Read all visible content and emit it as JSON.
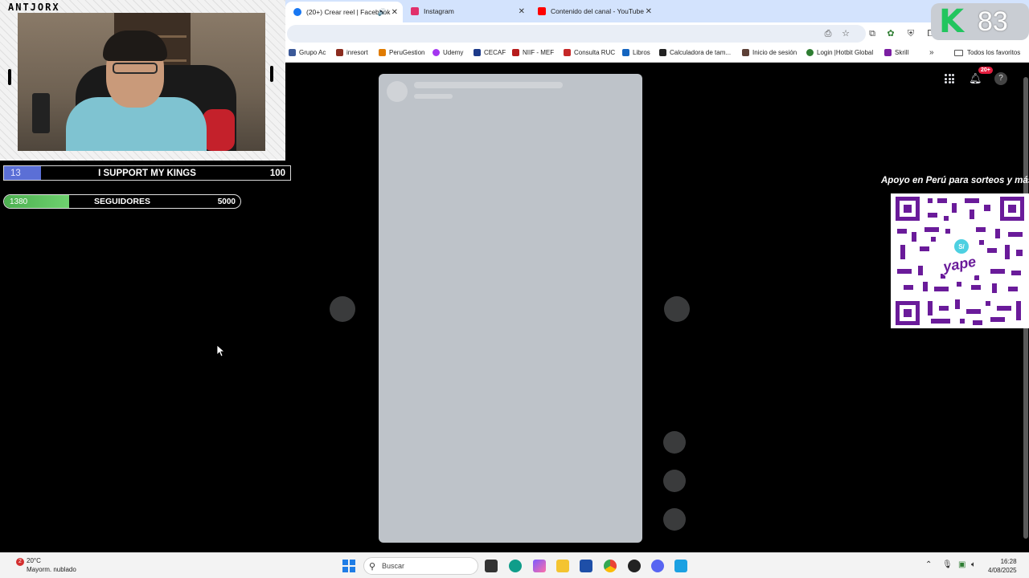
{
  "browser": {
    "tabs": [
      {
        "title": "(20+) Crear reel | Facebook",
        "color": "#1877f2",
        "active": true
      },
      {
        "title": "Instagram",
        "color": "#e1306c",
        "active": false
      },
      {
        "title": "Contenido del canal - YouTube",
        "color": "#ff0000",
        "active": false
      }
    ],
    "new_tab_label": "+",
    "bookmarks": [
      {
        "label": "Grupo Ac",
        "color": "#3b5998"
      },
      {
        "label": "inresort",
        "color": "#8b2c1f"
      },
      {
        "label": "PeruGestion",
        "color": "#e07b00"
      },
      {
        "label": "Udemy",
        "color": "#a435f0"
      },
      {
        "label": "CECAF",
        "color": "#1d3a8a"
      },
      {
        "label": "NIIF - MEF",
        "color": "#b71c1c"
      },
      {
        "label": "Consulta RUC",
        "color": "#c62828"
      },
      {
        "label": "Libros",
        "color": "#1565c0"
      },
      {
        "label": "Calculadora de tam...",
        "color": "#222222"
      },
      {
        "label": "Inicio de sesión",
        "color": "#5d4037"
      },
      {
        "label": "Login |Hotbit Global",
        "color": "#2e7d32"
      },
      {
        "label": "Skrill",
        "color": "#7b1fa2"
      }
    ],
    "bookmarks_more": "»",
    "all_bookmarks": "Todos los favoritos"
  },
  "facebook": {
    "notification_badge": "20+"
  },
  "overlay": {
    "channel_name": "ANTJORX",
    "goal_kings": {
      "current": "13",
      "label": "I SUPPORT MY KINGS",
      "max": "100",
      "progress": 0.13
    },
    "goal_followers": {
      "current": "1380",
      "label": "SEGUIDORES",
      "max": "5000",
      "progress": 0.276
    },
    "qr_caption": "Apoyo en Perú para sorteos y más",
    "qr_brand": "yape",
    "score_letter": "K",
    "score_number": "83"
  },
  "taskbar": {
    "weather_badge": "2",
    "temperature": "20°C",
    "weather_desc": "Mayorm. nublado",
    "search_placeholder": "Buscar",
    "time": "16:28",
    "date": "4/08/2025"
  },
  "colors": {
    "accent": "#1877f2",
    "tabstrip": "#d3e3fd",
    "goal_kings_fill": "#5b6fd6",
    "goal_followers_fill": "#4caf50",
    "qr_purple": "#6a1b9a",
    "score_green": "#22c55e"
  }
}
